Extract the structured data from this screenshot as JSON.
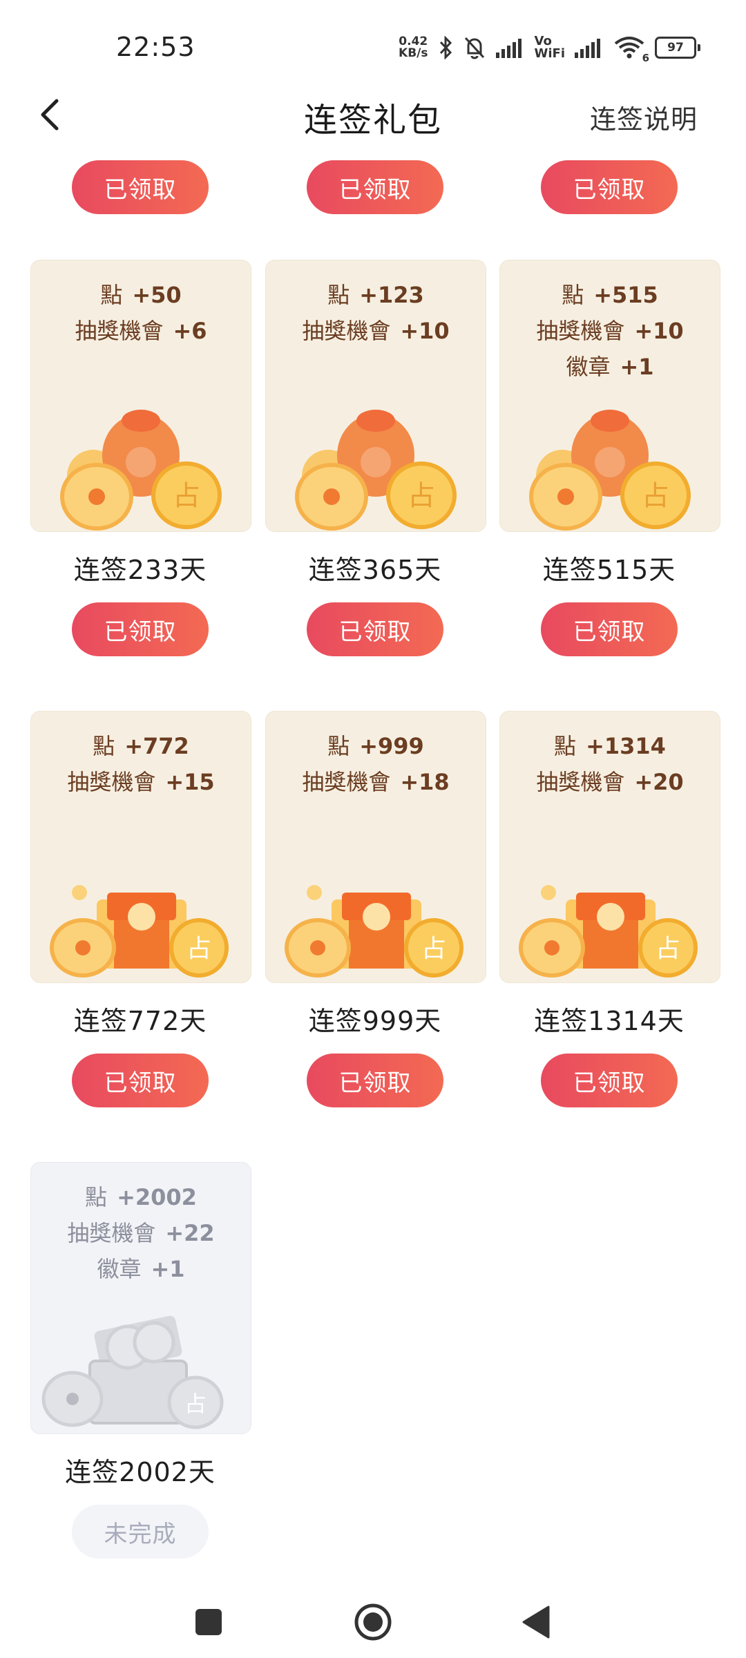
{
  "status_bar": {
    "time": "22:53",
    "net_speed_value": "0.42",
    "net_speed_unit": "KB/s",
    "vo_label": "Vo",
    "wifi_label": "WiFi",
    "wifi_badge": "6",
    "battery": "97"
  },
  "header": {
    "title": "连签礼包",
    "rules_link": "连签说明"
  },
  "top_row_buttons": [
    "已领取",
    "已领取",
    "已领取"
  ],
  "packs": [
    {
      "day_label": "连签233天",
      "button": "已领取",
      "rewards": [
        {
          "label": "點",
          "value": "+50"
        },
        {
          "label": "抽獎機會",
          "value": "+6"
        }
      ],
      "art": "coin-bag"
    },
    {
      "day_label": "连签365天",
      "button": "已领取",
      "rewards": [
        {
          "label": "點",
          "value": "+123"
        },
        {
          "label": "抽獎機會",
          "value": "+10"
        }
      ],
      "art": "coin-bag"
    },
    {
      "day_label": "连签515天",
      "button": "已领取",
      "rewards": [
        {
          "label": "點",
          "value": "+515"
        },
        {
          "label": "抽獎機會",
          "value": "+10"
        },
        {
          "label": "徽章",
          "value": "+1"
        }
      ],
      "art": "coin-bag"
    },
    {
      "day_label": "连签772天",
      "button": "已领取",
      "rewards": [
        {
          "label": "點",
          "value": "+772"
        },
        {
          "label": "抽獎機會",
          "value": "+15"
        }
      ],
      "art": "treasure-chest"
    },
    {
      "day_label": "连签999天",
      "button": "已领取",
      "rewards": [
        {
          "label": "點",
          "value": "+999"
        },
        {
          "label": "抽獎機會",
          "value": "+18"
        }
      ],
      "art": "treasure-chest"
    },
    {
      "day_label": "连签1314天",
      "button": "已领取",
      "rewards": [
        {
          "label": "點",
          "value": "+1314"
        },
        {
          "label": "抽獎機會",
          "value": "+20"
        }
      ],
      "art": "treasure-chest"
    },
    {
      "day_label": "连签2002天",
      "button": "未完成",
      "rewards": [
        {
          "label": "點",
          "value": "+2002"
        },
        {
          "label": "抽獎機會",
          "value": "+22"
        },
        {
          "label": "徽章",
          "value": "+1"
        }
      ],
      "art": "silver-chest"
    }
  ],
  "colors": {
    "button_gradient_start": "#e84a5f",
    "button_gradient_end": "#f36a53",
    "card_bg": "#f6efe1",
    "reward_text": "#6b3d22",
    "disabled_card_bg": "#f2f3f7",
    "disabled_text": "#a9adbb"
  },
  "nav_icons": [
    "square-recents-icon",
    "circle-home-icon",
    "triangle-back-icon"
  ]
}
